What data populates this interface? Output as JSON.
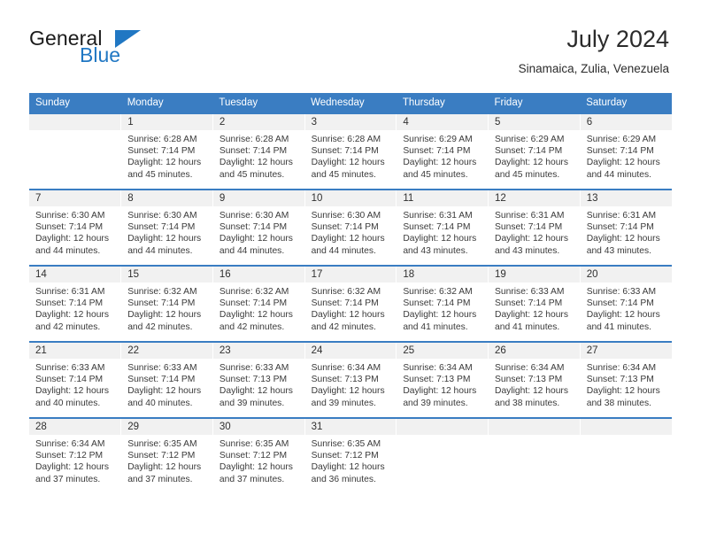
{
  "brand": {
    "name_part1": "General",
    "name_part2": "Blue",
    "triangle_color": "#2077c3"
  },
  "header": {
    "title": "July 2024",
    "subtitle": "Sinamaica, Zulia, Venezuela"
  },
  "theme": {
    "header_blue": "#3a7dc2",
    "daynum_band": "#f1f1f1",
    "text": "#3a3a3a"
  },
  "weekday_headers": [
    "Sunday",
    "Monday",
    "Tuesday",
    "Wednesday",
    "Thursday",
    "Friday",
    "Saturday"
  ],
  "weeks": [
    [
      {
        "day": "",
        "sunrise": "",
        "sunset": "",
        "daylight1": "",
        "daylight2": "",
        "empty": true
      },
      {
        "day": "1",
        "sunrise": "Sunrise: 6:28 AM",
        "sunset": "Sunset: 7:14 PM",
        "daylight1": "Daylight: 12 hours",
        "daylight2": "and 45 minutes."
      },
      {
        "day": "2",
        "sunrise": "Sunrise: 6:28 AM",
        "sunset": "Sunset: 7:14 PM",
        "daylight1": "Daylight: 12 hours",
        "daylight2": "and 45 minutes."
      },
      {
        "day": "3",
        "sunrise": "Sunrise: 6:28 AM",
        "sunset": "Sunset: 7:14 PM",
        "daylight1": "Daylight: 12 hours",
        "daylight2": "and 45 minutes."
      },
      {
        "day": "4",
        "sunrise": "Sunrise: 6:29 AM",
        "sunset": "Sunset: 7:14 PM",
        "daylight1": "Daylight: 12 hours",
        "daylight2": "and 45 minutes."
      },
      {
        "day": "5",
        "sunrise": "Sunrise: 6:29 AM",
        "sunset": "Sunset: 7:14 PM",
        "daylight1": "Daylight: 12 hours",
        "daylight2": "and 45 minutes."
      },
      {
        "day": "6",
        "sunrise": "Sunrise: 6:29 AM",
        "sunset": "Sunset: 7:14 PM",
        "daylight1": "Daylight: 12 hours",
        "daylight2": "and 44 minutes."
      }
    ],
    [
      {
        "day": "7",
        "sunrise": "Sunrise: 6:30 AM",
        "sunset": "Sunset: 7:14 PM",
        "daylight1": "Daylight: 12 hours",
        "daylight2": "and 44 minutes."
      },
      {
        "day": "8",
        "sunrise": "Sunrise: 6:30 AM",
        "sunset": "Sunset: 7:14 PM",
        "daylight1": "Daylight: 12 hours",
        "daylight2": "and 44 minutes."
      },
      {
        "day": "9",
        "sunrise": "Sunrise: 6:30 AM",
        "sunset": "Sunset: 7:14 PM",
        "daylight1": "Daylight: 12 hours",
        "daylight2": "and 44 minutes."
      },
      {
        "day": "10",
        "sunrise": "Sunrise: 6:30 AM",
        "sunset": "Sunset: 7:14 PM",
        "daylight1": "Daylight: 12 hours",
        "daylight2": "and 44 minutes."
      },
      {
        "day": "11",
        "sunrise": "Sunrise: 6:31 AM",
        "sunset": "Sunset: 7:14 PM",
        "daylight1": "Daylight: 12 hours",
        "daylight2": "and 43 minutes."
      },
      {
        "day": "12",
        "sunrise": "Sunrise: 6:31 AM",
        "sunset": "Sunset: 7:14 PM",
        "daylight1": "Daylight: 12 hours",
        "daylight2": "and 43 minutes."
      },
      {
        "day": "13",
        "sunrise": "Sunrise: 6:31 AM",
        "sunset": "Sunset: 7:14 PM",
        "daylight1": "Daylight: 12 hours",
        "daylight2": "and 43 minutes."
      }
    ],
    [
      {
        "day": "14",
        "sunrise": "Sunrise: 6:31 AM",
        "sunset": "Sunset: 7:14 PM",
        "daylight1": "Daylight: 12 hours",
        "daylight2": "and 42 minutes."
      },
      {
        "day": "15",
        "sunrise": "Sunrise: 6:32 AM",
        "sunset": "Sunset: 7:14 PM",
        "daylight1": "Daylight: 12 hours",
        "daylight2": "and 42 minutes."
      },
      {
        "day": "16",
        "sunrise": "Sunrise: 6:32 AM",
        "sunset": "Sunset: 7:14 PM",
        "daylight1": "Daylight: 12 hours",
        "daylight2": "and 42 minutes."
      },
      {
        "day": "17",
        "sunrise": "Sunrise: 6:32 AM",
        "sunset": "Sunset: 7:14 PM",
        "daylight1": "Daylight: 12 hours",
        "daylight2": "and 42 minutes."
      },
      {
        "day": "18",
        "sunrise": "Sunrise: 6:32 AM",
        "sunset": "Sunset: 7:14 PM",
        "daylight1": "Daylight: 12 hours",
        "daylight2": "and 41 minutes."
      },
      {
        "day": "19",
        "sunrise": "Sunrise: 6:33 AM",
        "sunset": "Sunset: 7:14 PM",
        "daylight1": "Daylight: 12 hours",
        "daylight2": "and 41 minutes."
      },
      {
        "day": "20",
        "sunrise": "Sunrise: 6:33 AM",
        "sunset": "Sunset: 7:14 PM",
        "daylight1": "Daylight: 12 hours",
        "daylight2": "and 41 minutes."
      }
    ],
    [
      {
        "day": "21",
        "sunrise": "Sunrise: 6:33 AM",
        "sunset": "Sunset: 7:14 PM",
        "daylight1": "Daylight: 12 hours",
        "daylight2": "and 40 minutes."
      },
      {
        "day": "22",
        "sunrise": "Sunrise: 6:33 AM",
        "sunset": "Sunset: 7:14 PM",
        "daylight1": "Daylight: 12 hours",
        "daylight2": "and 40 minutes."
      },
      {
        "day": "23",
        "sunrise": "Sunrise: 6:33 AM",
        "sunset": "Sunset: 7:13 PM",
        "daylight1": "Daylight: 12 hours",
        "daylight2": "and 39 minutes."
      },
      {
        "day": "24",
        "sunrise": "Sunrise: 6:34 AM",
        "sunset": "Sunset: 7:13 PM",
        "daylight1": "Daylight: 12 hours",
        "daylight2": "and 39 minutes."
      },
      {
        "day": "25",
        "sunrise": "Sunrise: 6:34 AM",
        "sunset": "Sunset: 7:13 PM",
        "daylight1": "Daylight: 12 hours",
        "daylight2": "and 39 minutes."
      },
      {
        "day": "26",
        "sunrise": "Sunrise: 6:34 AM",
        "sunset": "Sunset: 7:13 PM",
        "daylight1": "Daylight: 12 hours",
        "daylight2": "and 38 minutes."
      },
      {
        "day": "27",
        "sunrise": "Sunrise: 6:34 AM",
        "sunset": "Sunset: 7:13 PM",
        "daylight1": "Daylight: 12 hours",
        "daylight2": "and 38 minutes."
      }
    ],
    [
      {
        "day": "28",
        "sunrise": "Sunrise: 6:34 AM",
        "sunset": "Sunset: 7:12 PM",
        "daylight1": "Daylight: 12 hours",
        "daylight2": "and 37 minutes."
      },
      {
        "day": "29",
        "sunrise": "Sunrise: 6:35 AM",
        "sunset": "Sunset: 7:12 PM",
        "daylight1": "Daylight: 12 hours",
        "daylight2": "and 37 minutes."
      },
      {
        "day": "30",
        "sunrise": "Sunrise: 6:35 AM",
        "sunset": "Sunset: 7:12 PM",
        "daylight1": "Daylight: 12 hours",
        "daylight2": "and 37 minutes."
      },
      {
        "day": "31",
        "sunrise": "Sunrise: 6:35 AM",
        "sunset": "Sunset: 7:12 PM",
        "daylight1": "Daylight: 12 hours",
        "daylight2": "and 36 minutes."
      },
      {
        "day": "",
        "sunrise": "",
        "sunset": "",
        "daylight1": "",
        "daylight2": "",
        "empty": true
      },
      {
        "day": "",
        "sunrise": "",
        "sunset": "",
        "daylight1": "",
        "daylight2": "",
        "empty": true
      },
      {
        "day": "",
        "sunrise": "",
        "sunset": "",
        "daylight1": "",
        "daylight2": "",
        "empty": true
      }
    ]
  ]
}
